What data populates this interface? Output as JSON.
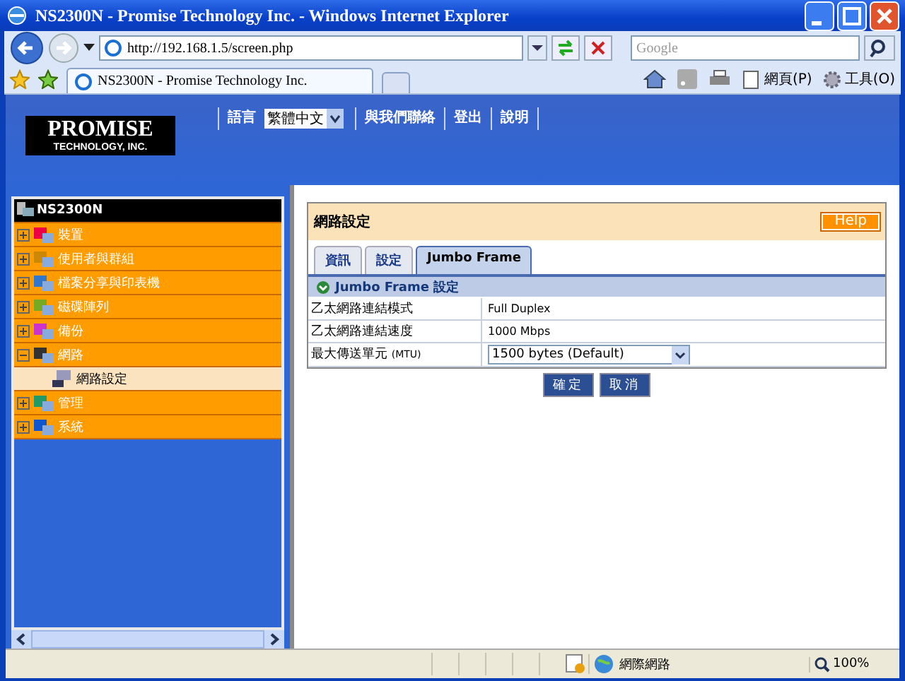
{
  "window": {
    "title": "NS2300N - Promise Technology Inc. - Windows Internet Explorer"
  },
  "address_bar": {
    "url": "http://192.168.1.5/screen.php"
  },
  "search": {
    "placeholder": "Google"
  },
  "browser_tabs": [
    {
      "label": "NS2300N - Promise Technology Inc.",
      "selected": true
    }
  ],
  "command_bar": [
    {
      "label": "網頁(P)"
    },
    {
      "label": "工具(O)"
    }
  ],
  "header": {
    "logo_name": "PROMISE",
    "logo_sub": "TECHNOLOGY, INC.",
    "language_label": "語言",
    "language_value": "繁體中文",
    "links": [
      "與我們聯絡",
      "登出",
      "說明"
    ]
  },
  "sidebar": {
    "root": "NS2300N",
    "items": [
      {
        "label": "裝置",
        "expanded": false
      },
      {
        "label": "使用者與群組",
        "expanded": false
      },
      {
        "label": "檔案分享與印表機",
        "expanded": false
      },
      {
        "label": "磁碟陣列",
        "expanded": false
      },
      {
        "label": "備份",
        "expanded": false
      },
      {
        "label": "網路",
        "expanded": true,
        "children": [
          {
            "label": "網路設定",
            "selected": true
          }
        ]
      },
      {
        "label": "管理",
        "expanded": false
      },
      {
        "label": "系統",
        "expanded": false
      }
    ]
  },
  "panel": {
    "title": "網路設定",
    "help": "Help",
    "tabs": [
      {
        "label": "資訊",
        "selected": false
      },
      {
        "label": "設定",
        "selected": false
      },
      {
        "label": "Jumbo Frame",
        "selected": true
      }
    ],
    "section": "Jumbo Frame 設定",
    "rows": [
      {
        "kind": "text",
        "label": "乙太網路連結模式",
        "value": "Full Duplex"
      },
      {
        "kind": "text",
        "label": "乙太網路連結速度",
        "value": "1000 Mbps"
      },
      {
        "kind": "select",
        "label": "最大傳送單元",
        "unit": "(MTU)",
        "value": "1500 bytes (Default)"
      }
    ],
    "buttons": [
      "確定",
      "取消"
    ]
  },
  "status_bar": {
    "zone": "網際網路",
    "zoom": "100%"
  }
}
